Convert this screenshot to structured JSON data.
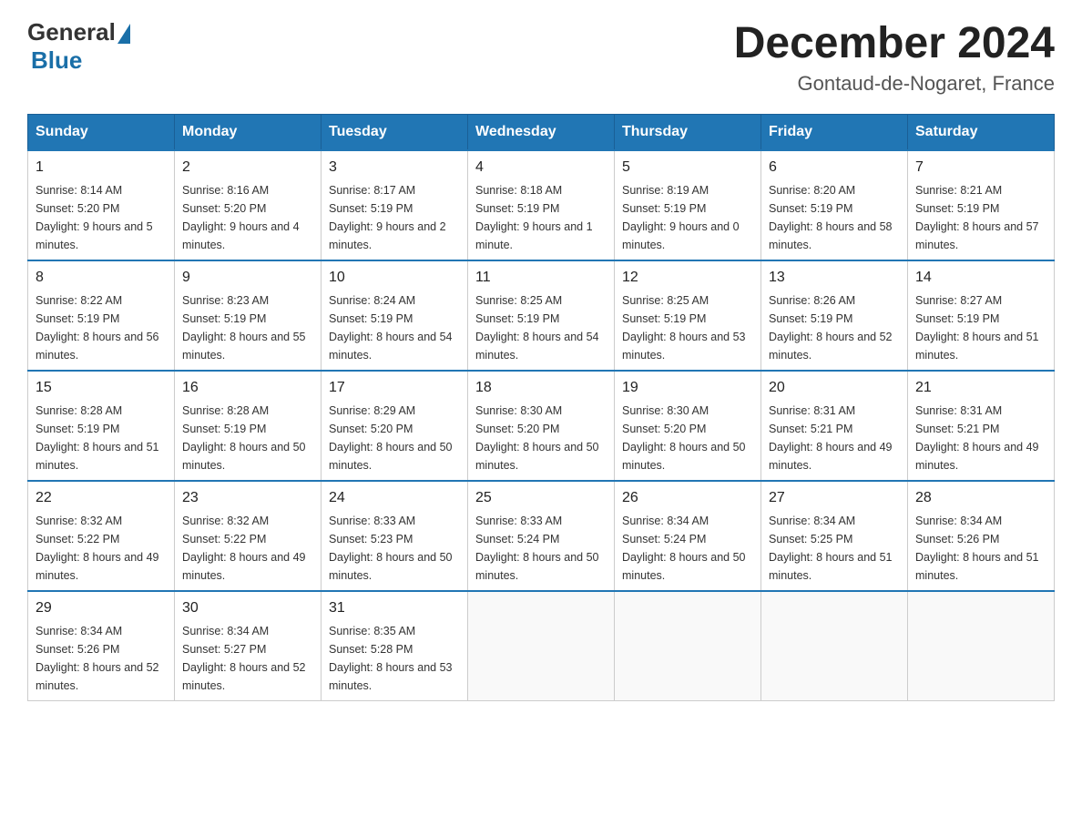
{
  "logo": {
    "general": "General",
    "blue": "Blue"
  },
  "title": "December 2024",
  "subtitle": "Gontaud-de-Nogaret, France",
  "days_header": [
    "Sunday",
    "Monday",
    "Tuesday",
    "Wednesday",
    "Thursday",
    "Friday",
    "Saturday"
  ],
  "weeks": [
    [
      {
        "day": "1",
        "sunrise": "8:14 AM",
        "sunset": "5:20 PM",
        "daylight": "9 hours and 5 minutes."
      },
      {
        "day": "2",
        "sunrise": "8:16 AM",
        "sunset": "5:20 PM",
        "daylight": "9 hours and 4 minutes."
      },
      {
        "day": "3",
        "sunrise": "8:17 AM",
        "sunset": "5:19 PM",
        "daylight": "9 hours and 2 minutes."
      },
      {
        "day": "4",
        "sunrise": "8:18 AM",
        "sunset": "5:19 PM",
        "daylight": "9 hours and 1 minute."
      },
      {
        "day": "5",
        "sunrise": "8:19 AM",
        "sunset": "5:19 PM",
        "daylight": "9 hours and 0 minutes."
      },
      {
        "day": "6",
        "sunrise": "8:20 AM",
        "sunset": "5:19 PM",
        "daylight": "8 hours and 58 minutes."
      },
      {
        "day": "7",
        "sunrise": "8:21 AM",
        "sunset": "5:19 PM",
        "daylight": "8 hours and 57 minutes."
      }
    ],
    [
      {
        "day": "8",
        "sunrise": "8:22 AM",
        "sunset": "5:19 PM",
        "daylight": "8 hours and 56 minutes."
      },
      {
        "day": "9",
        "sunrise": "8:23 AM",
        "sunset": "5:19 PM",
        "daylight": "8 hours and 55 minutes."
      },
      {
        "day": "10",
        "sunrise": "8:24 AM",
        "sunset": "5:19 PM",
        "daylight": "8 hours and 54 minutes."
      },
      {
        "day": "11",
        "sunrise": "8:25 AM",
        "sunset": "5:19 PM",
        "daylight": "8 hours and 54 minutes."
      },
      {
        "day": "12",
        "sunrise": "8:25 AM",
        "sunset": "5:19 PM",
        "daylight": "8 hours and 53 minutes."
      },
      {
        "day": "13",
        "sunrise": "8:26 AM",
        "sunset": "5:19 PM",
        "daylight": "8 hours and 52 minutes."
      },
      {
        "day": "14",
        "sunrise": "8:27 AM",
        "sunset": "5:19 PM",
        "daylight": "8 hours and 51 minutes."
      }
    ],
    [
      {
        "day": "15",
        "sunrise": "8:28 AM",
        "sunset": "5:19 PM",
        "daylight": "8 hours and 51 minutes."
      },
      {
        "day": "16",
        "sunrise": "8:28 AM",
        "sunset": "5:19 PM",
        "daylight": "8 hours and 50 minutes."
      },
      {
        "day": "17",
        "sunrise": "8:29 AM",
        "sunset": "5:20 PM",
        "daylight": "8 hours and 50 minutes."
      },
      {
        "day": "18",
        "sunrise": "8:30 AM",
        "sunset": "5:20 PM",
        "daylight": "8 hours and 50 minutes."
      },
      {
        "day": "19",
        "sunrise": "8:30 AM",
        "sunset": "5:20 PM",
        "daylight": "8 hours and 50 minutes."
      },
      {
        "day": "20",
        "sunrise": "8:31 AM",
        "sunset": "5:21 PM",
        "daylight": "8 hours and 49 minutes."
      },
      {
        "day": "21",
        "sunrise": "8:31 AM",
        "sunset": "5:21 PM",
        "daylight": "8 hours and 49 minutes."
      }
    ],
    [
      {
        "day": "22",
        "sunrise": "8:32 AM",
        "sunset": "5:22 PM",
        "daylight": "8 hours and 49 minutes."
      },
      {
        "day": "23",
        "sunrise": "8:32 AM",
        "sunset": "5:22 PM",
        "daylight": "8 hours and 49 minutes."
      },
      {
        "day": "24",
        "sunrise": "8:33 AM",
        "sunset": "5:23 PM",
        "daylight": "8 hours and 50 minutes."
      },
      {
        "day": "25",
        "sunrise": "8:33 AM",
        "sunset": "5:24 PM",
        "daylight": "8 hours and 50 minutes."
      },
      {
        "day": "26",
        "sunrise": "8:34 AM",
        "sunset": "5:24 PM",
        "daylight": "8 hours and 50 minutes."
      },
      {
        "day": "27",
        "sunrise": "8:34 AM",
        "sunset": "5:25 PM",
        "daylight": "8 hours and 51 minutes."
      },
      {
        "day": "28",
        "sunrise": "8:34 AM",
        "sunset": "5:26 PM",
        "daylight": "8 hours and 51 minutes."
      }
    ],
    [
      {
        "day": "29",
        "sunrise": "8:34 AM",
        "sunset": "5:26 PM",
        "daylight": "8 hours and 52 minutes."
      },
      {
        "day": "30",
        "sunrise": "8:34 AM",
        "sunset": "5:27 PM",
        "daylight": "8 hours and 52 minutes."
      },
      {
        "day": "31",
        "sunrise": "8:35 AM",
        "sunset": "5:28 PM",
        "daylight": "8 hours and 53 minutes."
      },
      null,
      null,
      null,
      null
    ]
  ],
  "labels": {
    "sunrise": "Sunrise:",
    "sunset": "Sunset:",
    "daylight": "Daylight:"
  }
}
